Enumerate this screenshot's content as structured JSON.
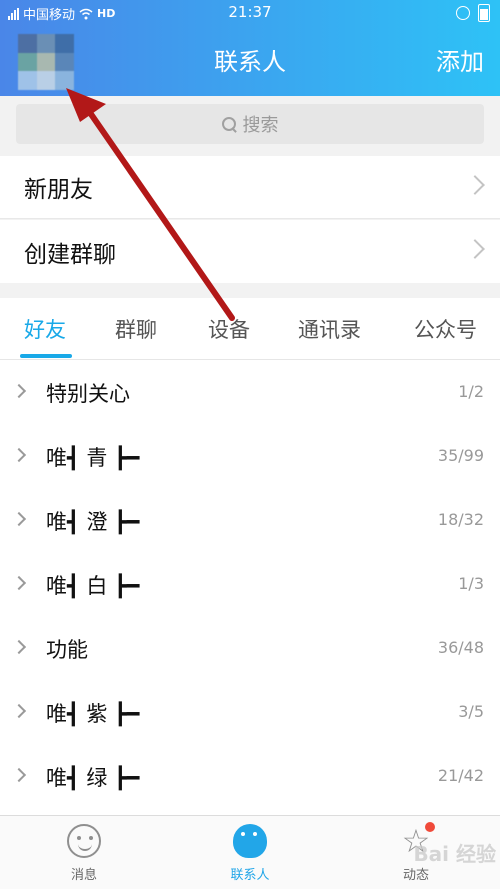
{
  "status_bar": {
    "carrier": "中国移动",
    "hd": "HD",
    "time": "21:37"
  },
  "header": {
    "title": "联系人",
    "add_label": "添加",
    "avatar_colors": [
      "#4d6fa3",
      "#6a8fb5",
      "#3f6ea8",
      "#6aa3a3",
      "#a8b8b0",
      "#5a86b8",
      "#9fc2e8",
      "#b9cfe6",
      "#8ab4de"
    ]
  },
  "search": {
    "placeholder": "搜索"
  },
  "menu": {
    "new_friends": "新朋友",
    "create_group": "创建群聊"
  },
  "tabs": [
    "好友",
    "群聊",
    "设备",
    "通讯录",
    "公众号"
  ],
  "active_tab": "好友",
  "groups": [
    {
      "name": "特别关心",
      "count": "1/2"
    },
    {
      "name": "唯┫ 青 ┣━",
      "count": "35/99"
    },
    {
      "name": "唯┫ 澄 ┣━",
      "count": "18/32"
    },
    {
      "name": "唯┫ 白 ┣━",
      "count": "1/3"
    },
    {
      "name": "功能",
      "count": "36/48"
    },
    {
      "name": "唯┫ 紫 ┣━",
      "count": "3/5"
    },
    {
      "name": "唯┫ 绿 ┣━",
      "count": "21/42"
    }
  ],
  "tabbar": {
    "messages": "消息",
    "contacts": "联系人",
    "activity": "动态"
  },
  "watermark": "Bai 经验",
  "colors": {
    "accent": "#19a9e8",
    "annotation_arrow": "#b21818"
  }
}
